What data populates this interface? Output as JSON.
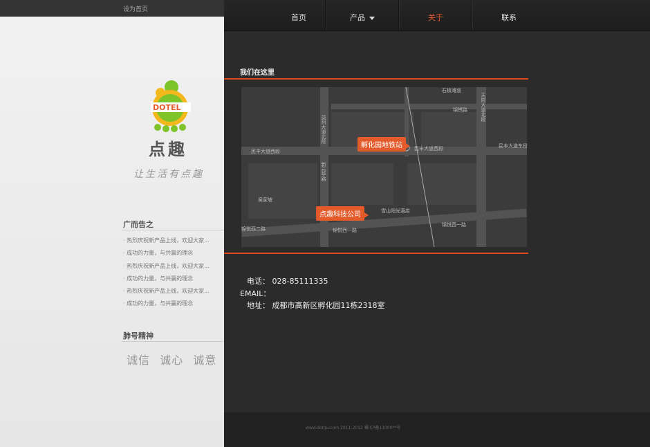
{
  "top": {
    "set_home": "设为首页"
  },
  "logo": {
    "brand": "DOTEL",
    "name": "点趣",
    "slogan": "让生活有点趣"
  },
  "sidebar": {
    "ads_title": "广而告之",
    "news": [
      "热烈庆祝新产品上线，欢迎大家...",
      "成功的力量，与共赢的理念",
      "热烈庆祝新产品上线，欢迎大家...",
      "成功的力量，与共赢的理念",
      "热烈庆祝新产品上线，欢迎大家...",
      "成功的力量，与共赢的理念"
    ],
    "spirit_title": "肺号精神",
    "values": [
      "诚信",
      "诚心",
      "诚意"
    ]
  },
  "nav": {
    "items": [
      {
        "label": "首页"
      },
      {
        "label": "产品"
      },
      {
        "label": "关于"
      },
      {
        "label": "联系"
      }
    ]
  },
  "main": {
    "title": "我们在这里",
    "map": {
      "label_metro": "孵化园地铁站",
      "label_company": "点趣科技公司",
      "streets": [
        "石板滩道",
        "锦锈路",
        "天府大道北段",
        "益州大道北段",
        "民丰大道西段",
        "民丰大道西段",
        "民丰大道东段",
        "吴家坡",
        "新元华路",
        "雪山阳光酒店",
        "锦悦西二路",
        "锦悦西一路",
        "锦悦西一路"
      ]
    },
    "contact": {
      "phone_label": "电话：",
      "phone": "028-85111335",
      "email_label": "EMAIL：",
      "address_label": "地址：",
      "address": "成都市高新区孵化园11栋2318室"
    }
  },
  "footer": {
    "text": "www.dotqu.com 2011-2012  蜀ICP备11000**号"
  },
  "colors": {
    "accent": "#e35a2b",
    "nav_bg": "#1f1f1f",
    "sidebar_bg": "#ececec"
  }
}
